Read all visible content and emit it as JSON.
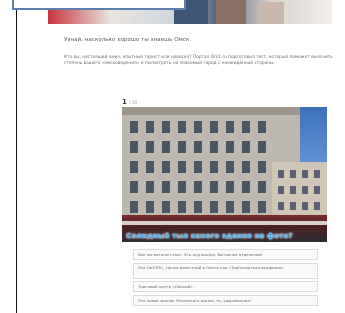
{
  "article": {
    "headline": "Узнай, насколько хорошо ты знаешь Омск.",
    "intro": "Кто вы, настоящий омич, опытный турист или новосел? Портал Om1.ru подготовил тест, который поможет выяснить степень вашего «омсковедения» и посмотреть на знакомый город с неожиданной стороны."
  },
  "quiz": {
    "question_number": "1",
    "question_total": "/ 10",
    "caption": "Солидный тыл какого здания на фото?",
    "answers": [
      "Вон же вагоны стоят. Это ж/д вокзал, багажное отделение!",
      "Это ОмГУПС, также известный в Омске как «Транспортная академия».",
      "Торговый центр «Омский».",
      "Это новое здание Леченского рынка, то, здоровенное!"
    ]
  },
  "colors": {
    "caption": "#4aa3e0",
    "border": "#dcdcdc"
  }
}
